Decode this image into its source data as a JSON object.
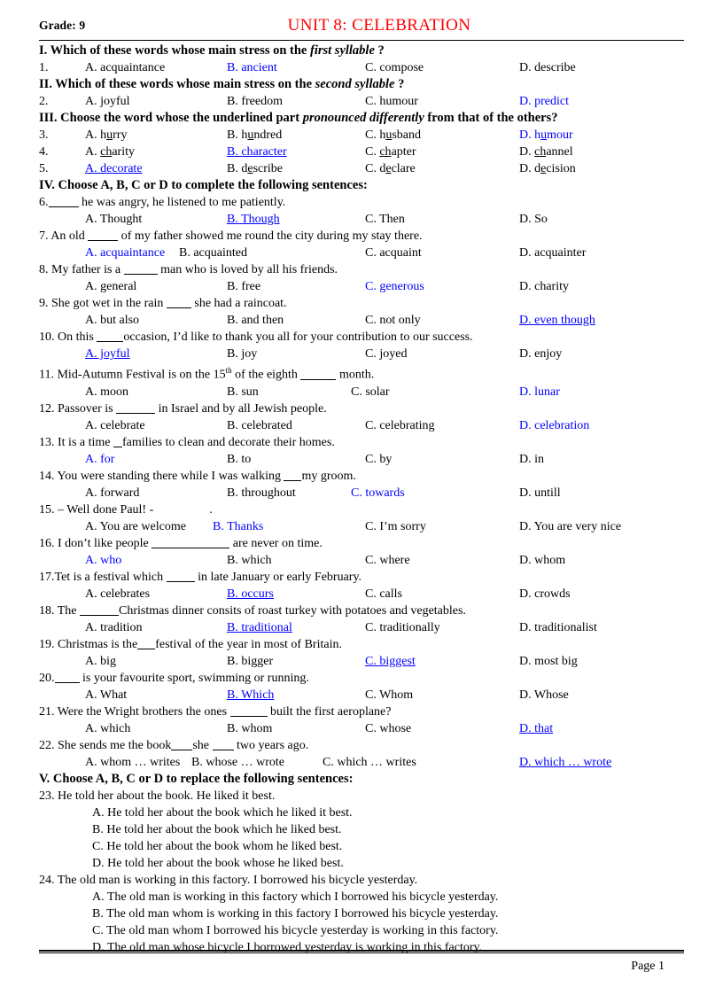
{
  "header": {
    "grade": "Grade: 9",
    "unit_title": "UNIT  8: CELEBRATION"
  },
  "footer": {
    "page_number": "Page 1"
  },
  "sections": {
    "I": {
      "prefix": "I. Which  of these words  whose main  stress on the ",
      "italic": "first syllable",
      "suffix": " ?"
    },
    "II": {
      "prefix": "II. Which  of these words  whose main  stress on the ",
      "italic": "second syllable",
      "suffix": " ?"
    },
    "III": {
      "prefix": "III. Choose the word  whose the underlined  part ",
      "italic": "pronounced differently",
      "suffix": " from  that of the others?"
    },
    "IV": {
      "text": "IV. Choose A, B, C or D to complete the following  sentences:"
    },
    "V": {
      "text": "V. Choose A, B, C or D to replace the following  sentences:"
    }
  },
  "questions": {
    "q1": {
      "number": "1.",
      "options": [
        {
          "label": "A. acquaintance",
          "correct": false
        },
        {
          "label": "B. ancient",
          "correct": true
        },
        {
          "label": "C. compose",
          "correct": false
        },
        {
          "label": "D. describe",
          "correct": false
        }
      ]
    },
    "q2": {
      "number": "2.",
      "options": [
        {
          "label": "A. joyful",
          "correct": false
        },
        {
          "label": "B. freedom",
          "correct": false
        },
        {
          "label": "C. humour",
          "correct": false
        },
        {
          "label": "D. predict",
          "correct": true
        }
      ]
    },
    "q3": {
      "number": "3.",
      "options": [
        {
          "pre": "A. h",
          "mark": "u",
          "post": "rry",
          "correct": false
        },
        {
          "pre": "B. h",
          "mark": "u",
          "post": "ndred",
          "correct": false
        },
        {
          "pre": "C. h",
          "mark": "u",
          "post": "sband",
          "correct": false
        },
        {
          "pre": "D. h",
          "mark": "u",
          "post": "mour",
          "correct": true
        }
      ]
    },
    "q4": {
      "number": "4.",
      "options": [
        {
          "pre": "A. ",
          "mark": "ch",
          "post": "arity",
          "correct": false
        },
        {
          "pre": "B. ",
          "mark": "ch",
          "post": "aracter",
          "correct": true
        },
        {
          "pre": "C. ",
          "mark": "ch",
          "post": "apter",
          "correct": false
        },
        {
          "pre": "D. ",
          "mark": "ch",
          "post": "annel",
          "correct": false
        }
      ]
    },
    "q5": {
      "number": "5.",
      "options": [
        {
          "pre": "A. d",
          "mark": "e",
          "post": "corate",
          "correct": true
        },
        {
          "pre": "B. d",
          "mark": "e",
          "post": "scribe",
          "correct": false
        },
        {
          "pre": "C. d",
          "mark": "e",
          "post": "clare",
          "correct": false
        },
        {
          "pre": "D. d",
          "mark": "e",
          "post": "cision",
          "correct": false
        }
      ]
    },
    "q6": {
      "stem_pre": "6.",
      "stem_blank": 34,
      "stem_post": " he was angry,  he listened  to me patiently.",
      "options": [
        {
          "label": "A. Thought",
          "correct": false
        },
        {
          "label": "B. Though",
          "correct": true
        },
        {
          "label": "C. Then",
          "correct": false
        },
        {
          "label": "D. So",
          "correct": false
        }
      ]
    },
    "q7": {
      "stem_pre": "7. An old ",
      "stem_blank": 34,
      "stem_post": " of my father  showed me round  the city  during  my stay there.",
      "options": [
        {
          "label": "A. acquaintance",
          "correct": true
        },
        {
          "label": "B. acquainted",
          "correct": false
        },
        {
          "label": "C. acquaint",
          "correct": false
        },
        {
          "label": "D. acquainter",
          "correct": false
        }
      ]
    },
    "q8": {
      "stem_pre": "8. My father  is a ",
      "stem_blank": 38,
      "stem_post": " man who is loved  by all  his friends.",
      "options": [
        {
          "label": "A. general",
          "correct": false
        },
        {
          "label": "B. free",
          "correct": false
        },
        {
          "label": "C. generous",
          "correct": true
        },
        {
          "label": "D. charity",
          "correct": false
        }
      ]
    },
    "q9": {
      "stem_pre": "9. She got wet in the rain ",
      "stem_blank": 28,
      "stem_post": " she had a raincoat.",
      "options": [
        {
          "label": "A. but also",
          "correct": false
        },
        {
          "label": "B. and then",
          "correct": false
        },
        {
          "label": "C. not only",
          "correct": false
        },
        {
          "label": "D. even though",
          "correct": true
        }
      ]
    },
    "q10": {
      "stem_pre": "10. On this ",
      "stem_blank": 30,
      "stem_post": "occasion, I’d like  to thank  you all  for your  contribution  to our success.",
      "options": [
        {
          "label": "A. joyful",
          "correct": true
        },
        {
          "label": "B. joy",
          "correct": false
        },
        {
          "label": "C. joyed",
          "correct": false
        },
        {
          "label": "D. enjoy",
          "correct": false
        }
      ]
    },
    "q11": {
      "stem_pre": "11. Mid-Autumn  Festival  is on the 15",
      "stem_sup": "th",
      "stem_mid": " of the eighth  ",
      "stem_blank": 40,
      "stem_post": " month.",
      "options": [
        {
          "label": "A. moon",
          "correct": false
        },
        {
          "label": "B. sun",
          "correct": false
        },
        {
          "label": "C. solar",
          "correct": false
        },
        {
          "label": "D. lunar",
          "correct": true
        }
      ]
    },
    "q12": {
      "stem_pre": "12. Passover is ",
      "stem_blank": 44,
      "stem_post": " in Israel  and by all  Jewish  people.",
      "options": [
        {
          "label": "A. celebrate",
          "correct": false
        },
        {
          "label": "B. celebrated",
          "correct": false
        },
        {
          "label": "C. celebrating",
          "correct": false
        },
        {
          "label": "D. celebration",
          "correct": true
        }
      ]
    },
    "q13": {
      "stem_pre": "13. It is a time ",
      "stem_blank": 10,
      "stem_post": "families   to clean  and decorate their  homes.",
      "options": [
        {
          "label": "A. for",
          "correct": true
        },
        {
          "label": "B. to",
          "correct": false
        },
        {
          "label": "C. by",
          "correct": false
        },
        {
          "label": "D. in",
          "correct": false
        }
      ]
    },
    "q14": {
      "stem_pre": "14. You were standing  there while  I was walking  ",
      "stem_blank": 20,
      "stem_post": "my groom.",
      "options": [
        {
          "label": "A. forward",
          "correct": false
        },
        {
          "label": "B. throughout",
          "correct": false
        },
        {
          "label": "C. towards",
          "correct": true
        },
        {
          "label": "D. untill",
          "correct": false
        }
      ]
    },
    "q15": {
      "stem_pre": "15. – Well  done Paul!  -",
      "stem_blank": 0,
      "stem_post": "                  .",
      "options": [
        {
          "label": "A. You are welcome",
          "correct": false
        },
        {
          "label": "B. Thanks",
          "correct": true
        },
        {
          "label": "C. I’m sorry",
          "correct": false
        },
        {
          "label": "D. You are very nice",
          "correct": false
        }
      ]
    },
    "q16": {
      "stem_pre": "16. I don’t like people ",
      "stem_blank": 88,
      "stem_post": " are never on time.",
      "options": [
        {
          "label": "A. who",
          "correct": true
        },
        {
          "label": "B. which",
          "correct": false
        },
        {
          "label": "C. where",
          "correct": false
        },
        {
          "label": "D. whom",
          "correct": false
        }
      ]
    },
    "q17": {
      "stem_pre": "17.Tet is a festival  which ",
      "stem_blank": 32,
      "stem_post": " in late January  or early  February.",
      "options": [
        {
          "label": "A. celebrates",
          "correct": false
        },
        {
          "label": "B. occurs",
          "correct": true
        },
        {
          "label": "C. calls",
          "correct": false
        },
        {
          "label": "D. crowds",
          "correct": false
        }
      ]
    },
    "q18": {
      "stem_pre": "18. The ",
      "stem_blank": 44,
      "stem_post": "Christmas  dinner  consits  of roast turkey  with  potatoes and vegetables.",
      "options": [
        {
          "label": "A. tradition",
          "correct": false
        },
        {
          "label": "B. traditional",
          "correct": true
        },
        {
          "label": "C. traditionally",
          "correct": false
        },
        {
          "label": "D. traditionalist",
          "correct": false
        }
      ]
    },
    "q19": {
      "stem_pre": "19. Christmas  is the",
      "stem_blank": 20,
      "stem_post": "festival  of the year in most of Britain.",
      "options": [
        {
          "label": "A. big",
          "correct": false
        },
        {
          "label": "B. bigger",
          "correct": false
        },
        {
          "label": "C. biggest",
          "correct": true
        },
        {
          "label": "D. most big",
          "correct": false
        }
      ]
    },
    "q20": {
      "stem_pre": "20.",
      "stem_blank": 28,
      "stem_post": " is your favourite  sport, swimming   or running.",
      "options": [
        {
          "label": "A. What",
          "correct": false
        },
        {
          "label": "B. Which",
          "correct": true
        },
        {
          "label": "C. Whom",
          "correct": false
        },
        {
          "label": "D. Whose",
          "correct": false
        }
      ]
    },
    "q21": {
      "stem_pre": "21. Were the Wright  brothers the ones ",
      "stem_blank": 42,
      "stem_post": " built  the first  aeroplane?",
      "options": [
        {
          "label": "A. which",
          "correct": false
        },
        {
          "label": "B. whom",
          "correct": false
        },
        {
          "label": "C. whose",
          "correct": false
        },
        {
          "label": "D. that",
          "correct": true
        }
      ]
    },
    "q22": {
      "stem_pre": "22. She sends me the book",
      "stem_blank": 24,
      "stem_mid": "she ",
      "stem_blank2": 24,
      "stem_post": " two years ago.",
      "options": [
        {
          "label": "A. whom … writes",
          "correct": false
        },
        {
          "label": "B. whose … wrote",
          "correct": false
        },
        {
          "label": "C. which … writes",
          "correct": false
        },
        {
          "label": "D. which  … wrote",
          "correct": true
        }
      ]
    },
    "q23": {
      "stem": "23. He told her about the book. He liked  it best.",
      "options": [
        {
          "label": "A. He told her about the  book which  he liked it best.",
          "correct": false
        },
        {
          "label": "B. He told her about the book which  he liked best.",
          "correct": false
        },
        {
          "label": "C. He told her about the book whom  he liked best.",
          "correct": false
        },
        {
          "label": "D. He told her about the book whose he liked best.",
          "correct": false
        }
      ]
    },
    "q24": {
      "stem": "24. The old man is working  in this factory.  I borrowed his bicycle  yesterday.",
      "options": [
        {
          "label": "A. The  old man is working  in this factory which  I borrowed his bicycle  yesterday.",
          "correct": false
        },
        {
          "label": "B. The  old man whom  is working  in this factory  I borrowed his bicycle  yesterday.",
          "correct": false
        },
        {
          "label": "C. The  old man  whom  I borrowed his bicycle  yesterday is working  in this factory.",
          "correct": false
        },
        {
          "label": "D. The  old man  whose bicycle  I borrowed yesterday  is working  in this factory.",
          "correct": false
        }
      ]
    }
  },
  "colors": {
    "answer_blue": "#0000ff",
    "title_red": "#ff0000",
    "text_black": "#000000"
  }
}
